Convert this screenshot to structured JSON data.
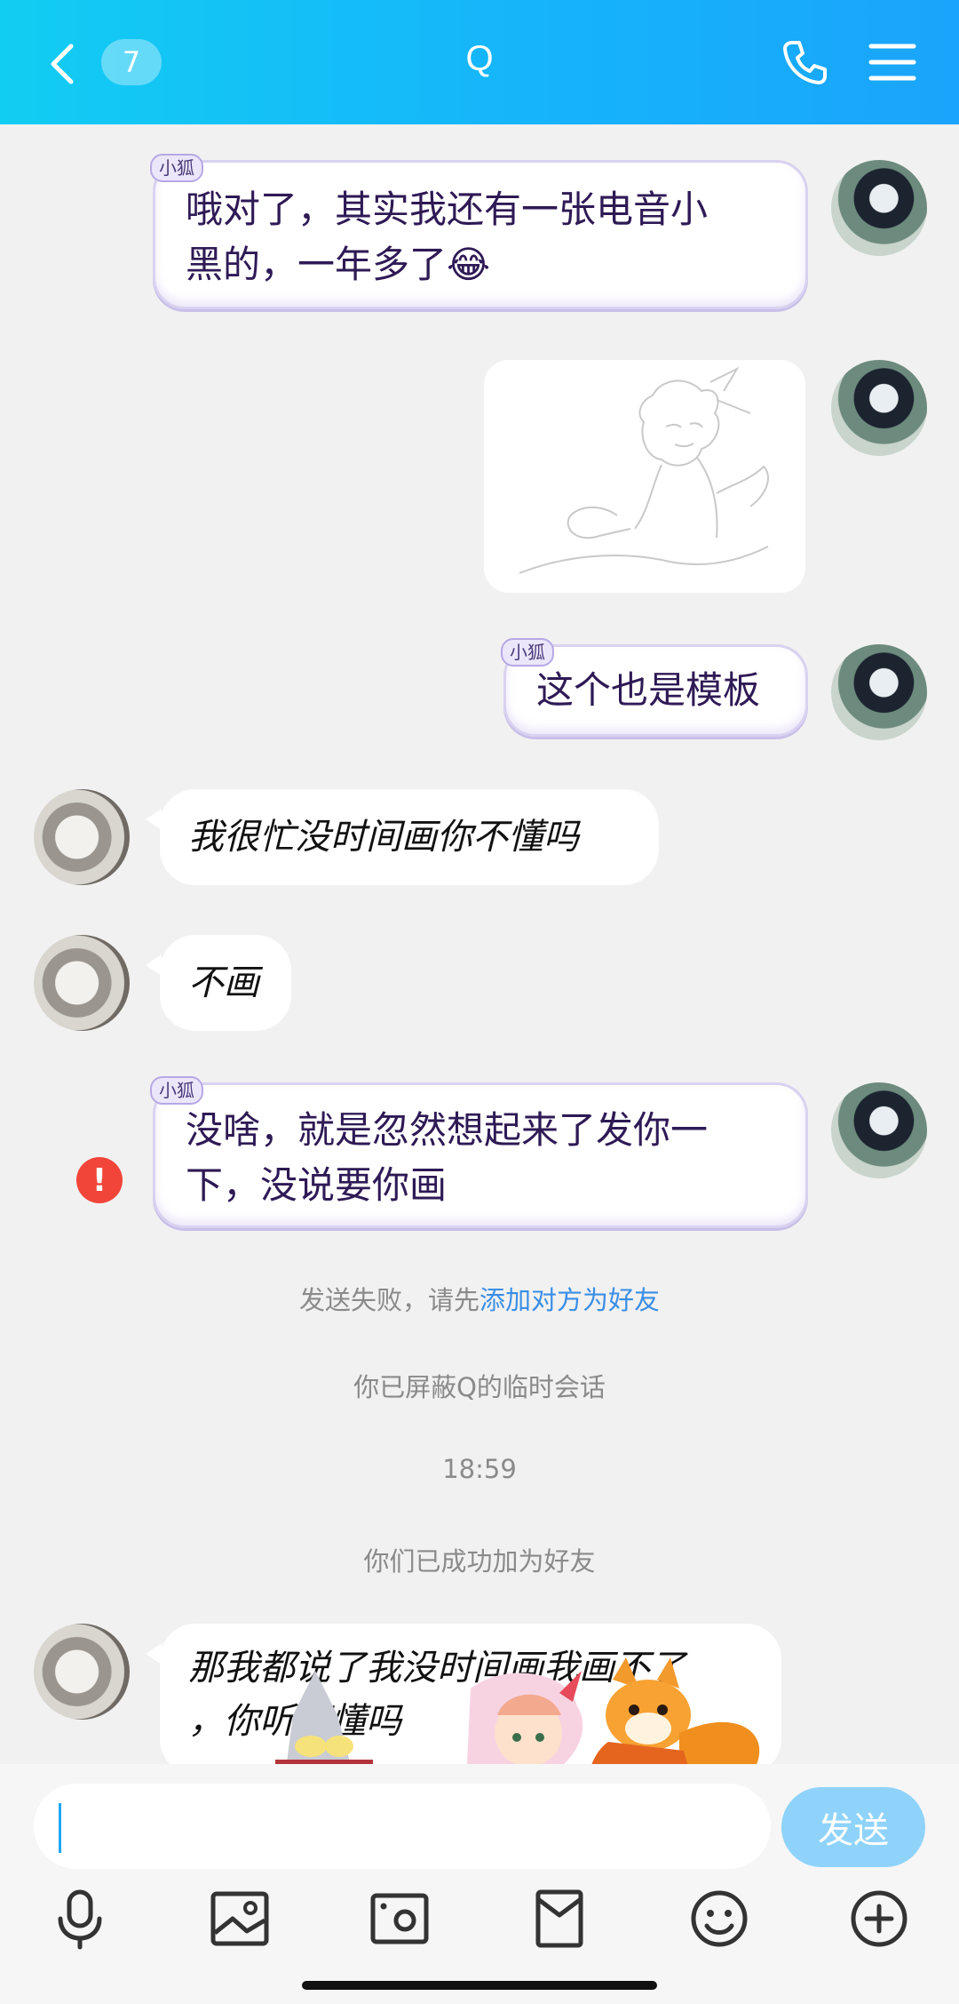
{
  "header": {
    "back_badge": "7",
    "title": "Q"
  },
  "messages": [
    {
      "sender": "self",
      "tag": "小狐",
      "text_lines": [
        "哦对了，其实我还有一张电音小",
        "黑的，一年多了😂"
      ]
    },
    {
      "sender": "self",
      "type": "image"
    },
    {
      "sender": "self",
      "tag": "小狐",
      "text_lines": [
        "这个也是模板"
      ]
    },
    {
      "sender": "other",
      "text_lines": [
        "我很忙没时间画你不懂吗"
      ]
    },
    {
      "sender": "other",
      "text_lines": [
        "不画"
      ]
    },
    {
      "sender": "self",
      "tag": "小狐",
      "text_lines": [
        "没啥，就是忽然想起来了发你一",
        "下，没说要你画"
      ],
      "error_icon": "!"
    },
    {
      "sender": "other",
      "text_lines": [
        "那我都说了我没时间画我画不了",
        "，你听不懂吗"
      ]
    }
  ],
  "system": {
    "send_failed_prefix": "发送失败，请先",
    "send_failed_link": "添加对方为好友",
    "blocked": "你已屏蔽Q的临时会话",
    "time": "18:59",
    "friends_added": "你们已成功加为好友"
  },
  "input": {
    "value": "",
    "send_label": "发送"
  },
  "toolbar": {
    "icons": [
      "microphone-icon",
      "image-icon",
      "camera-icon",
      "red-packet-icon",
      "emoji-icon",
      "plus-icon"
    ]
  },
  "colors": {
    "header_start": "#12cdf2",
    "header_end": "#1aa4fb",
    "send_button": "#8fd3fb",
    "error": "#f2453a",
    "link": "#3a8ee6"
  }
}
